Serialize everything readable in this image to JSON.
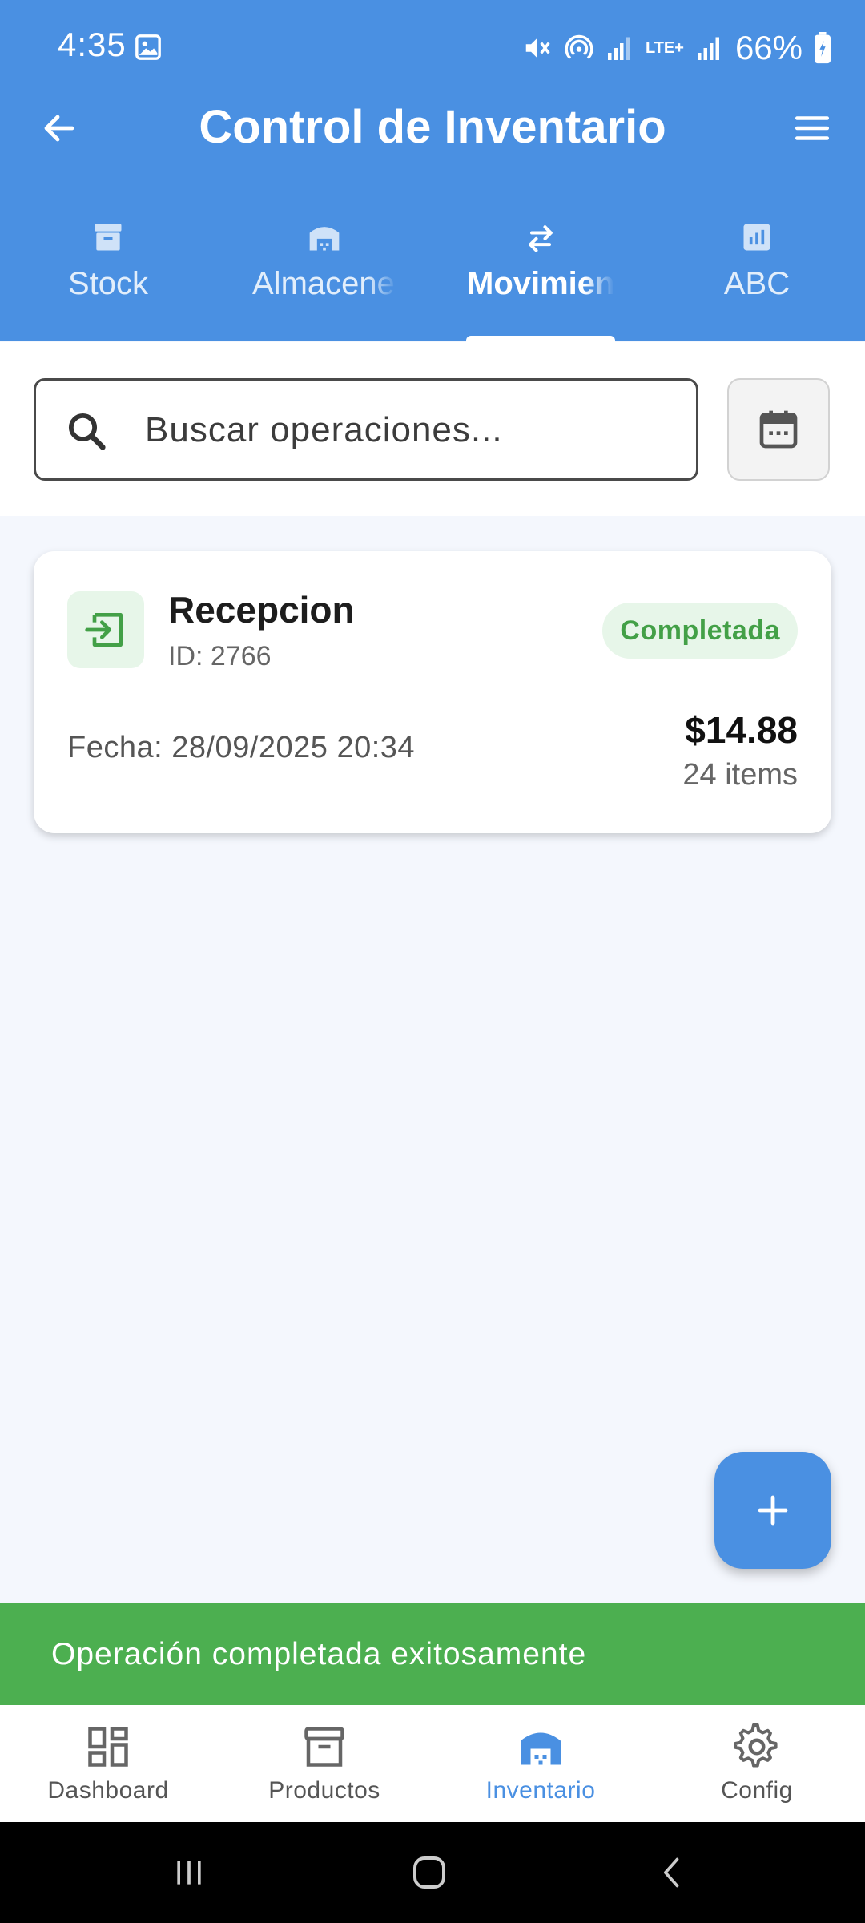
{
  "status_bar": {
    "time": "4:35",
    "battery": "66%",
    "network": "LTE+"
  },
  "header": {
    "title": "Control de Inventario"
  },
  "tabs": [
    {
      "label": "Stock",
      "icon": "archive-icon",
      "active": false
    },
    {
      "label": "Almacenes",
      "icon": "warehouse-icon",
      "active": false
    },
    {
      "label": "Movimientos",
      "icon": "swap-arrows-icon",
      "active": true
    },
    {
      "label": "ABC",
      "icon": "bar-chart-icon",
      "active": false
    }
  ],
  "search": {
    "placeholder": "Buscar operaciones..."
  },
  "operations": [
    {
      "type": "Recepcion",
      "id_label": "ID: 2766",
      "status": "Completada",
      "date_label": "Fecha: 28/09/2025 20:34",
      "total": "$14.88",
      "items": "24 items"
    }
  ],
  "snackbar": {
    "message": "Operación completada exitosamente"
  },
  "bottom_nav": [
    {
      "label": "Dashboard",
      "icon": "dashboard-icon",
      "active": false
    },
    {
      "label": "Productos",
      "icon": "archive-icon",
      "active": false
    },
    {
      "label": "Inventario",
      "icon": "warehouse-icon",
      "active": true
    },
    {
      "label": "Config",
      "icon": "gear-icon",
      "active": false
    }
  ],
  "colors": {
    "primary": "#4a90e2",
    "success": "#4caf50",
    "success_light": "#e7f6e9",
    "background": "#f4f7fd"
  }
}
